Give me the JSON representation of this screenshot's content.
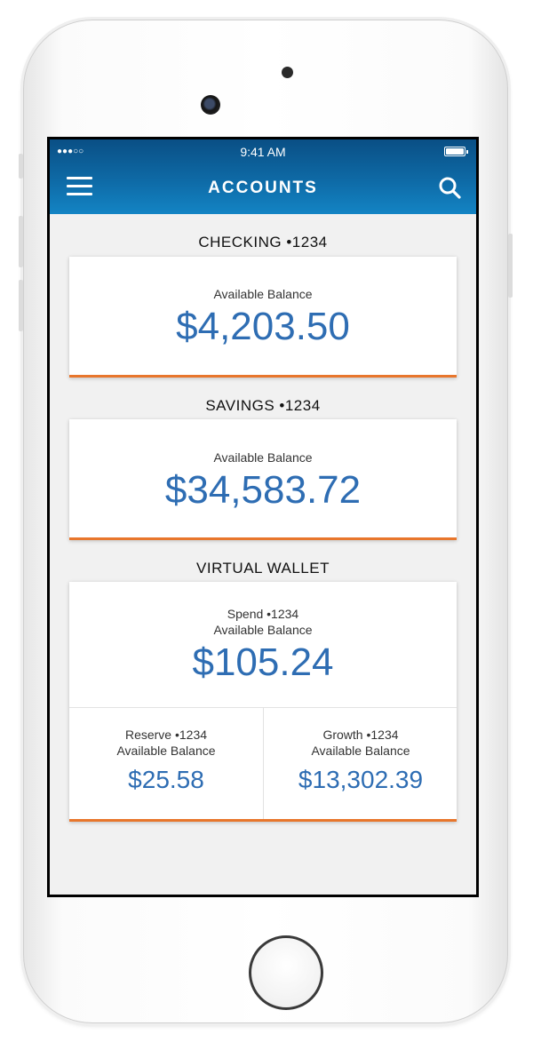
{
  "status_bar": {
    "signal": "●●●○○",
    "time": "9:41 AM"
  },
  "nav": {
    "title": "ACCOUNTS",
    "menu_icon": "hamburger-menu-icon",
    "search_icon": "search-icon"
  },
  "accounts": {
    "checking": {
      "heading": "CHECKING •1234",
      "balance_label": "Available Balance",
      "balance": "$4,203.50"
    },
    "savings": {
      "heading": "SAVINGS •1234",
      "balance_label": "Available Balance",
      "balance": "$34,583.72"
    },
    "virtual_wallet": {
      "heading": "VIRTUAL WALLET",
      "spend": {
        "name": "Spend •1234",
        "balance_label": "Available Balance",
        "balance": "$105.24"
      },
      "reserve": {
        "name": "Reserve •1234",
        "balance_label": "Available Balance",
        "balance": "$25.58"
      },
      "growth": {
        "name": "Growth •1234",
        "balance_label": "Available Balance",
        "balance": "$13,302.39"
      }
    }
  },
  "colors": {
    "accent_orange": "#e8762c",
    "amount_blue": "#2e6db3",
    "nav_blue": "#0e6aa6"
  }
}
